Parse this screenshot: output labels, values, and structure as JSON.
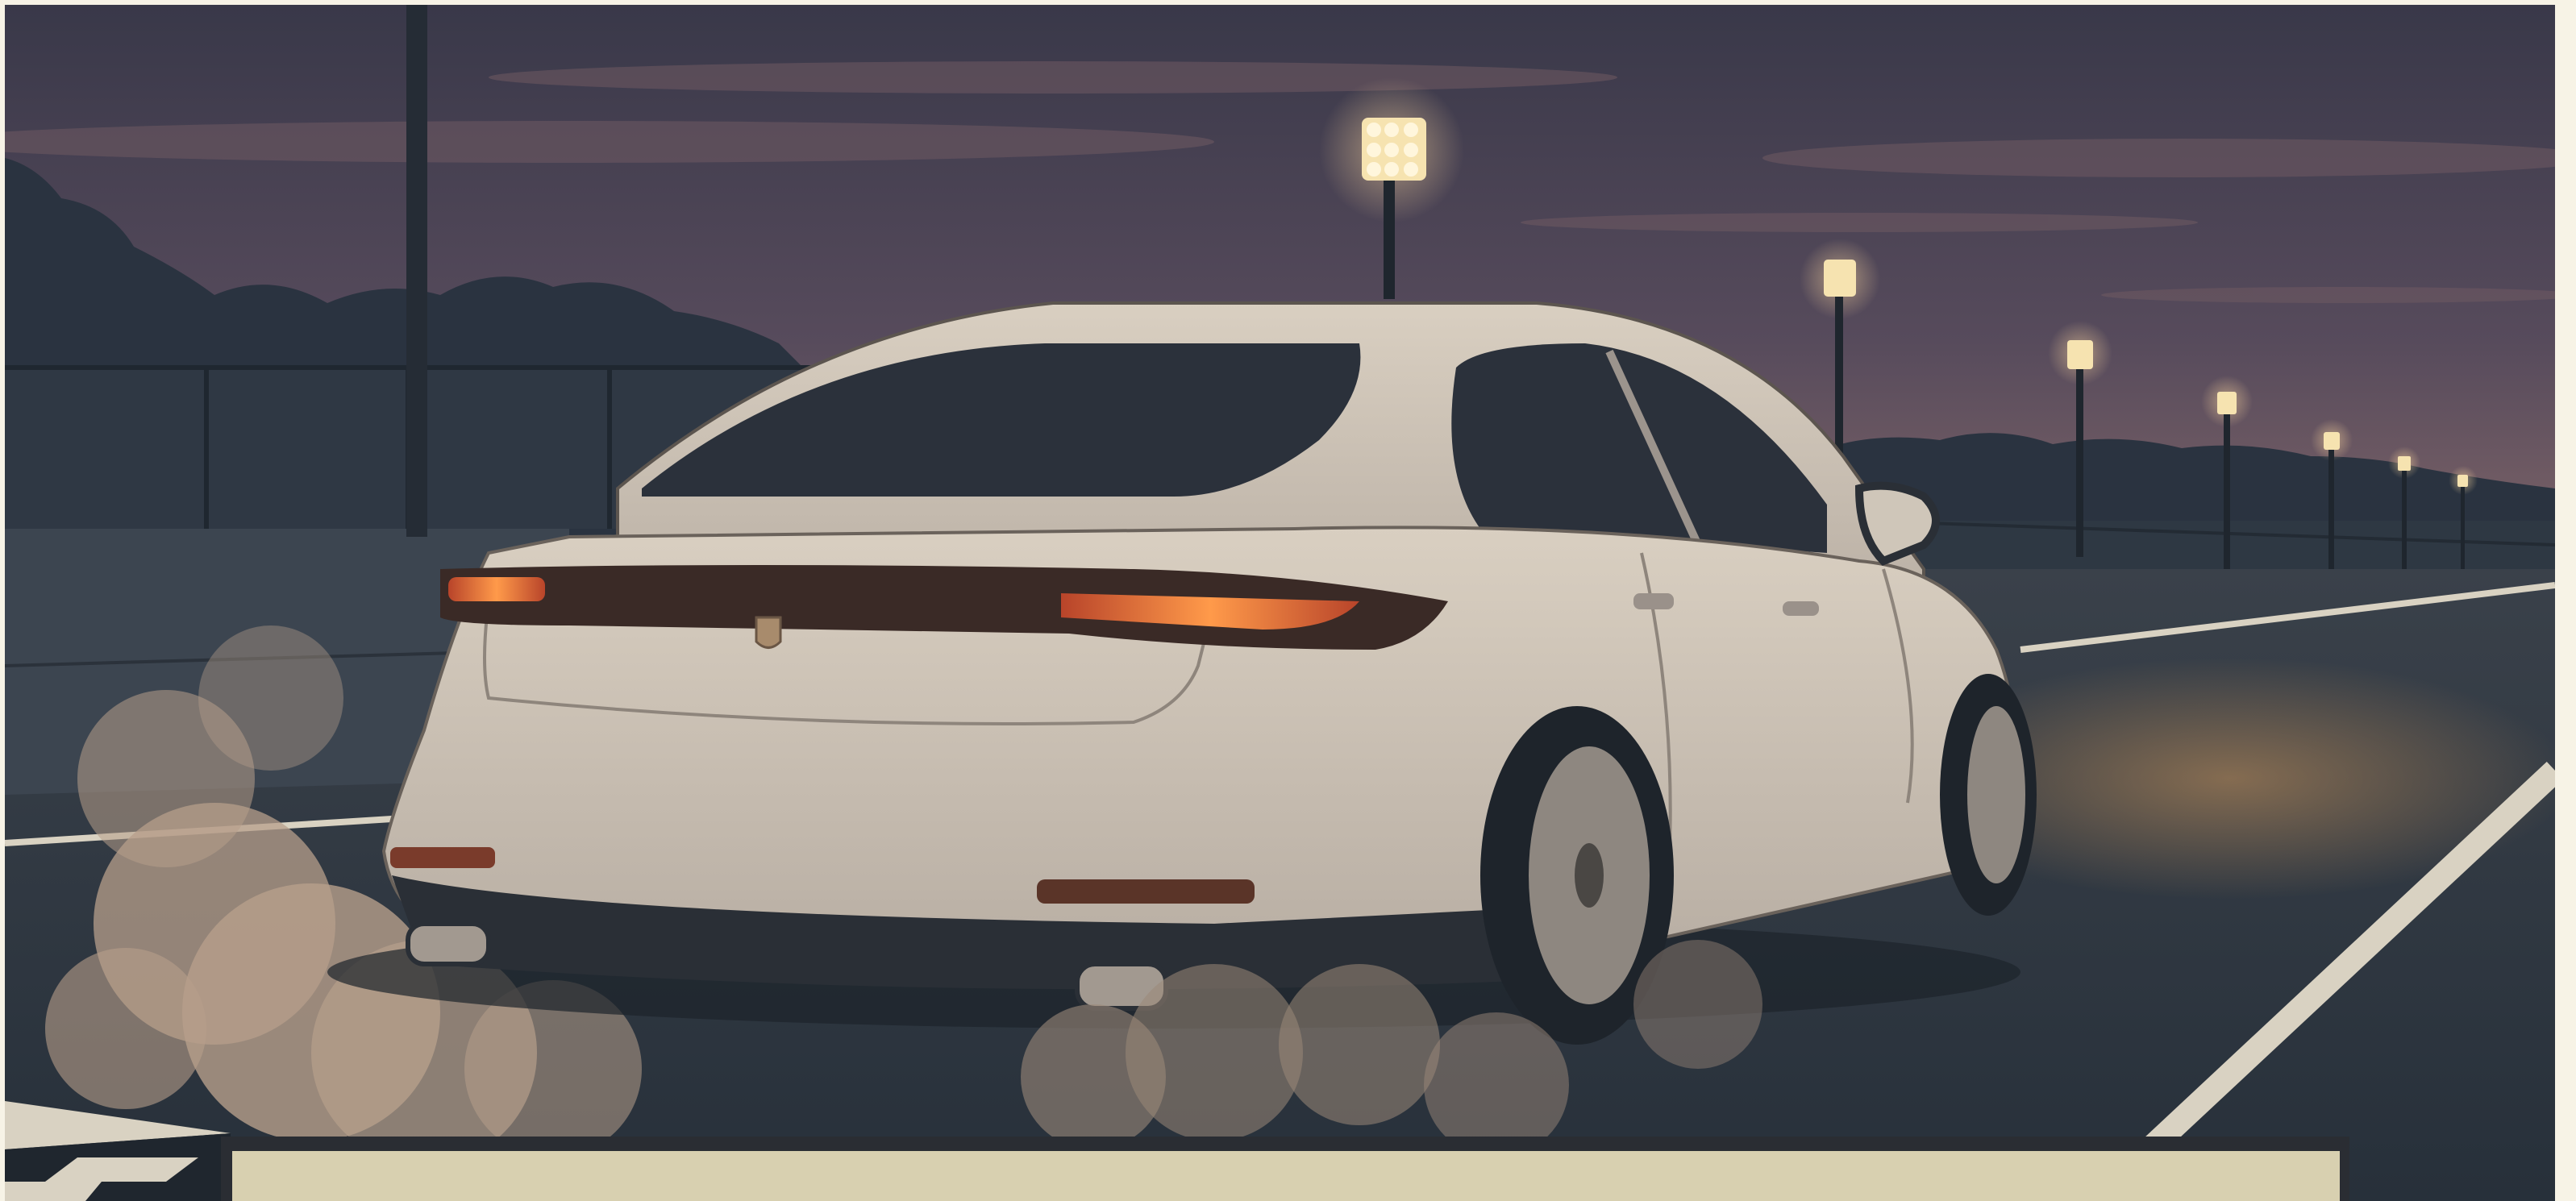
{
  "scene": {
    "subject": "car-illustration",
    "palette": {
      "sky_top": "#3b3a4c",
      "sky_mid": "#5b4e5e",
      "sky_horizon": "#8b6d6a",
      "tree_silhouette": "#2b3441",
      "fence": "#2f3a45",
      "wall": "#3d4650",
      "track": "#2f3841",
      "track_light": "#6b5a4a",
      "line_white": "#d9d2c2",
      "car_body": "#cfc6b9",
      "car_shadow": "#a89f96",
      "glass": "#2c323c",
      "taillight": "#e97a3a",
      "taillight_glow": "#ffb35c",
      "smoke": "#b9a08c",
      "lamp": "#f6e3b0",
      "banner": "#d8d0b0",
      "banner_border": "#2a2d33",
      "frame": "#f7f3e6"
    },
    "icons": [
      "car-badge-icon",
      "floodlight-icon"
    ]
  }
}
